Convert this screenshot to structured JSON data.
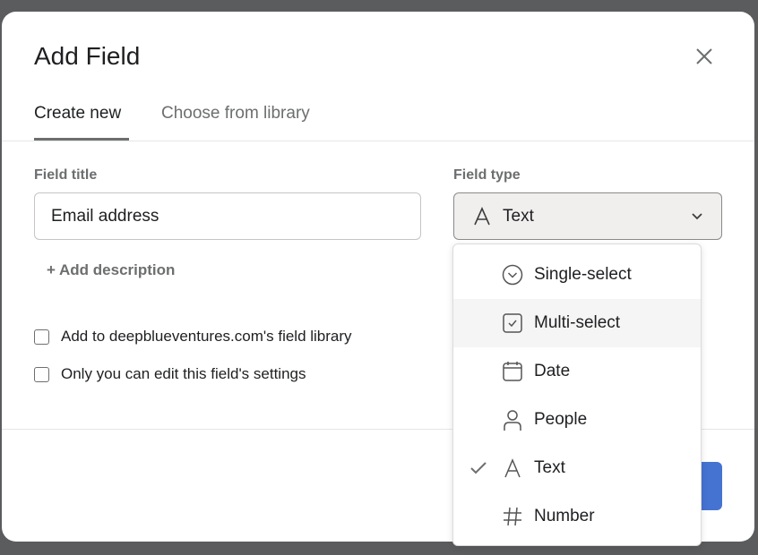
{
  "dialog": {
    "title": "Add Field",
    "close_icon": "close-icon"
  },
  "tabs": [
    {
      "label": "Create new",
      "active": true
    },
    {
      "label": "Choose from library",
      "active": false
    }
  ],
  "form": {
    "field_title_label": "Field title",
    "field_title_value": "Email address",
    "field_type_label": "Field type",
    "field_type_value": "Text",
    "add_description": "+ Add description",
    "checkboxes": [
      {
        "label": "Add to deepblueventures.com's field library",
        "checked": false
      },
      {
        "label": "Only you can edit this field's settings",
        "checked": false
      }
    ]
  },
  "dropdown": {
    "items": [
      {
        "label": "Single-select",
        "icon": "chevron-circle-icon"
      },
      {
        "label": "Multi-select",
        "icon": "checkbox-icon",
        "hovered": true
      },
      {
        "label": "Date",
        "icon": "calendar-icon"
      },
      {
        "label": "People",
        "icon": "person-icon"
      },
      {
        "label": "Text",
        "icon": "text-icon",
        "selected": true
      },
      {
        "label": "Number",
        "icon": "hash-icon"
      }
    ]
  },
  "colors": {
    "primary_button": "#4573d2",
    "backdrop": "#5b5c5e"
  }
}
